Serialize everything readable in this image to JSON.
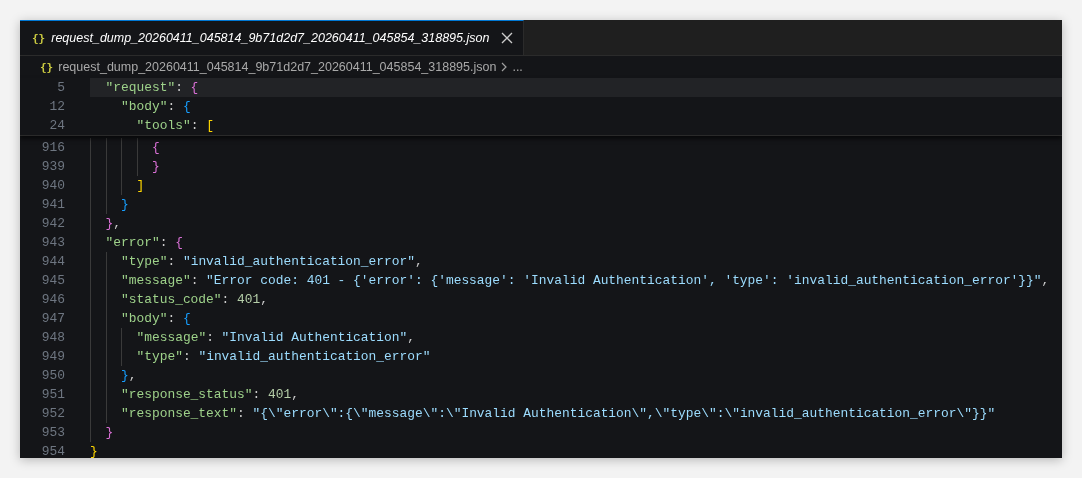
{
  "tab": {
    "icon": "{}",
    "title": "request_dump_20260411_045814_9b71d2d7_20260411_045854_318895.json",
    "selected": true
  },
  "breadcrumb": {
    "icon": "{}",
    "file": "request_dump_20260411_045814_9b71d2d7_20260411_045854_318895.json",
    "more": "..."
  },
  "sticky_lines": [
    {
      "number": "5",
      "guides": [
        {
          "kind": "blank"
        }
      ],
      "highlighted": true,
      "tokens": [
        {
          "kind": "key",
          "text": "\"request\""
        },
        {
          "kind": "punct",
          "text": ": "
        },
        {
          "kind": "bracket",
          "text": "{",
          "color": "#da70d6"
        }
      ]
    },
    {
      "number": "12",
      "guides": [
        {
          "kind": "blank"
        },
        {
          "kind": "blank"
        }
      ],
      "highlighted": false,
      "tokens": [
        {
          "kind": "key",
          "text": "\"body\""
        },
        {
          "kind": "punct",
          "text": ": "
        },
        {
          "kind": "bracket",
          "text": "{",
          "color": "#179fff"
        }
      ]
    },
    {
      "number": "24",
      "guides": [
        {
          "kind": "blank"
        },
        {
          "kind": "blank"
        },
        {
          "kind": "blank"
        }
      ],
      "highlighted": false,
      "tokens": [
        {
          "kind": "key",
          "text": "\"tools\""
        },
        {
          "kind": "punct",
          "text": ": "
        },
        {
          "kind": "bracket",
          "text": "[",
          "color": "#ffd700"
        }
      ]
    }
  ],
  "lines": [
    {
      "number": "916",
      "guides": [
        {
          "kind": "line"
        },
        {
          "kind": "line"
        },
        {
          "kind": "line"
        },
        {
          "kind": "line"
        }
      ],
      "tokens": [
        {
          "kind": "bracket",
          "text": "{",
          "color": "#da70d6"
        }
      ]
    },
    {
      "number": "939",
      "guides": [
        {
          "kind": "line"
        },
        {
          "kind": "line"
        },
        {
          "kind": "line"
        },
        {
          "kind": "line"
        }
      ],
      "tokens": [
        {
          "kind": "bracket",
          "text": "}",
          "color": "#da70d6"
        }
      ]
    },
    {
      "number": "940",
      "guides": [
        {
          "kind": "line"
        },
        {
          "kind": "line"
        },
        {
          "kind": "line"
        }
      ],
      "tokens": [
        {
          "kind": "bracket",
          "text": "]",
          "color": "#ffd700"
        }
      ]
    },
    {
      "number": "941",
      "guides": [
        {
          "kind": "line"
        },
        {
          "kind": "line"
        }
      ],
      "tokens": [
        {
          "kind": "bracket",
          "text": "}",
          "color": "#179fff"
        }
      ]
    },
    {
      "number": "942",
      "guides": [
        {
          "kind": "line"
        }
      ],
      "tokens": [
        {
          "kind": "bracket",
          "text": "}",
          "color": "#da70d6"
        },
        {
          "kind": "punct",
          "text": ","
        }
      ]
    },
    {
      "number": "943",
      "guides": [
        {
          "kind": "line"
        }
      ],
      "tokens": [
        {
          "kind": "key",
          "text": "\"error\""
        },
        {
          "kind": "punct",
          "text": ": "
        },
        {
          "kind": "bracket",
          "text": "{",
          "color": "#da70d6"
        }
      ]
    },
    {
      "number": "944",
      "guides": [
        {
          "kind": "line"
        },
        {
          "kind": "line"
        }
      ],
      "tokens": [
        {
          "kind": "key",
          "text": "\"type\""
        },
        {
          "kind": "punct",
          "text": ": "
        },
        {
          "kind": "string",
          "text": "\"invalid_authentication_error\""
        },
        {
          "kind": "punct",
          "text": ","
        }
      ]
    },
    {
      "number": "945",
      "guides": [
        {
          "kind": "line"
        },
        {
          "kind": "line"
        }
      ],
      "tokens": [
        {
          "kind": "key",
          "text": "\"message\""
        },
        {
          "kind": "punct",
          "text": ": "
        },
        {
          "kind": "string",
          "text": "\"Error code: 401 - {'error': {'message': 'Invalid Authentication', 'type': 'invalid_authentication_error'}}\""
        },
        {
          "kind": "punct",
          "text": ","
        }
      ]
    },
    {
      "number": "946",
      "guides": [
        {
          "kind": "line"
        },
        {
          "kind": "line"
        }
      ],
      "tokens": [
        {
          "kind": "key",
          "text": "\"status_code\""
        },
        {
          "kind": "punct",
          "text": ": "
        },
        {
          "kind": "number",
          "text": "401"
        },
        {
          "kind": "punct",
          "text": ","
        }
      ]
    },
    {
      "number": "947",
      "guides": [
        {
          "kind": "line"
        },
        {
          "kind": "line"
        }
      ],
      "tokens": [
        {
          "kind": "key",
          "text": "\"body\""
        },
        {
          "kind": "punct",
          "text": ": "
        },
        {
          "kind": "bracket",
          "text": "{",
          "color": "#179fff"
        }
      ]
    },
    {
      "number": "948",
      "guides": [
        {
          "kind": "line"
        },
        {
          "kind": "line"
        },
        {
          "kind": "line"
        }
      ],
      "tokens": [
        {
          "kind": "key",
          "text": "\"message\""
        },
        {
          "kind": "punct",
          "text": ": "
        },
        {
          "kind": "string",
          "text": "\"Invalid Authentication\""
        },
        {
          "kind": "punct",
          "text": ","
        }
      ]
    },
    {
      "number": "949",
      "guides": [
        {
          "kind": "line"
        },
        {
          "kind": "line"
        },
        {
          "kind": "line"
        }
      ],
      "tokens": [
        {
          "kind": "key",
          "text": "\"type\""
        },
        {
          "kind": "punct",
          "text": ": "
        },
        {
          "kind": "string",
          "text": "\"invalid_authentication_error\""
        }
      ]
    },
    {
      "number": "950",
      "guides": [
        {
          "kind": "line"
        },
        {
          "kind": "line"
        }
      ],
      "tokens": [
        {
          "kind": "bracket",
          "text": "}",
          "color": "#179fff"
        },
        {
          "kind": "punct",
          "text": ","
        }
      ]
    },
    {
      "number": "951",
      "guides": [
        {
          "kind": "line"
        },
        {
          "kind": "line"
        }
      ],
      "tokens": [
        {
          "kind": "key",
          "text": "\"response_status\""
        },
        {
          "kind": "punct",
          "text": ": "
        },
        {
          "kind": "number",
          "text": "401"
        },
        {
          "kind": "punct",
          "text": ","
        }
      ]
    },
    {
      "number": "952",
      "guides": [
        {
          "kind": "line"
        },
        {
          "kind": "line"
        }
      ],
      "tokens": [
        {
          "kind": "key",
          "text": "\"response_text\""
        },
        {
          "kind": "punct",
          "text": ": "
        },
        {
          "kind": "string",
          "text": "\"{\\\"error\\\":{\\\"message\\\":\\\"Invalid Authentication\\\",\\\"type\\\":\\\"invalid_authentication_error\\\"}}\""
        }
      ]
    },
    {
      "number": "953",
      "guides": [
        {
          "kind": "line"
        }
      ],
      "tokens": [
        {
          "kind": "bracket",
          "text": "}",
          "color": "#da70d6"
        }
      ]
    },
    {
      "number": "954",
      "tokens": [
        {
          "kind": "bracket",
          "text": "}",
          "color": "#ffd700"
        }
      ]
    }
  ]
}
